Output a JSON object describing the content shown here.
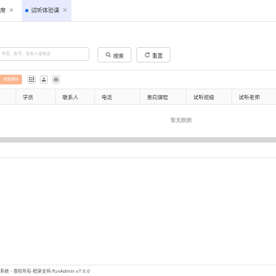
{
  "tabs": [
    {
      "label": "席",
      "active": false
    },
    {
      "label": "试听体验课",
      "active": true
    }
  ],
  "search": {
    "placeholder": "学员、账号、联系人或电话",
    "search_label": "搜索",
    "reset_label": "重置"
  },
  "toolbar": {
    "primary_label": "批量删除",
    "icons": [
      "grid-icon",
      "export-icon",
      "print-icon"
    ]
  },
  "table": {
    "columns": [
      "学员",
      "联系人",
      "电话",
      "意向课程",
      "试听班级",
      "试听老师"
    ],
    "empty_text": "暂无数据"
  },
  "footer": {
    "text": "系统 - 版权所有-框架支持:FunAdmin v7.0.0"
  },
  "colors": {
    "accent_blue": "#1e6ce8",
    "active_tab_bg": "#e6ecfd",
    "orange_button": "#fbb58e"
  }
}
